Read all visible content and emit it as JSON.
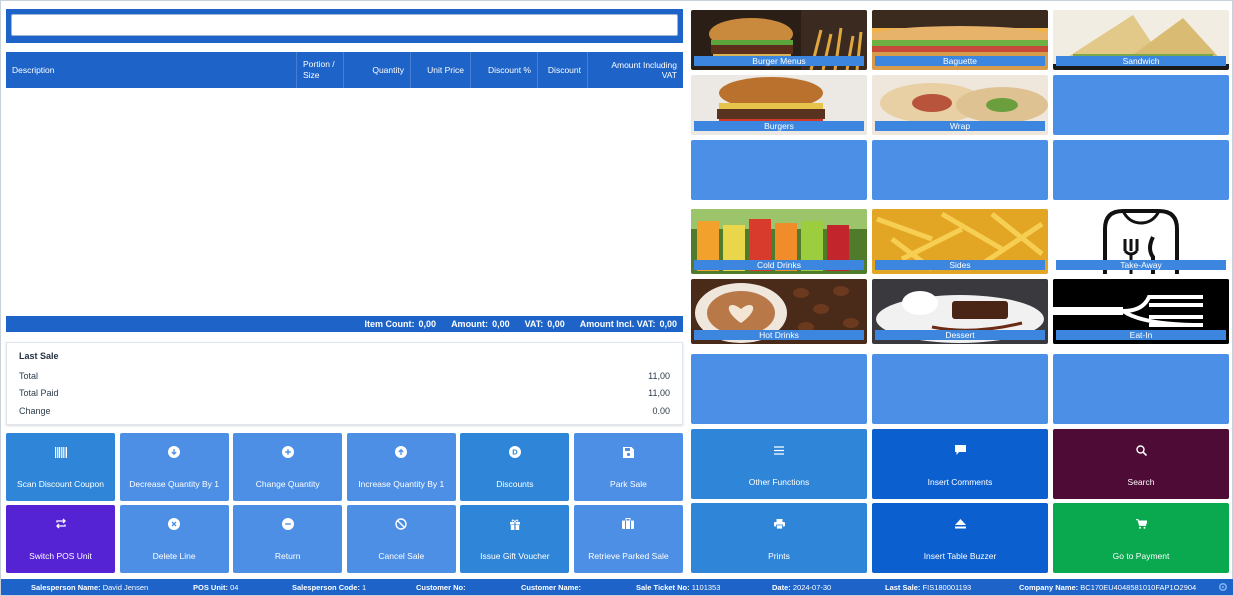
{
  "search": {
    "value": "",
    "placeholder": ""
  },
  "grid": {
    "columns": [
      "Description",
      "Portion / Size",
      "Quantity",
      "Unit Price",
      "Discount %",
      "Discount",
      "Amount Including VAT"
    ],
    "rows": []
  },
  "totals": {
    "item_count_label": "Item Count:",
    "item_count": "0,00",
    "amount_label": "Amount:",
    "amount": "0,00",
    "vat_label": "VAT:",
    "vat": "0,00",
    "amount_incl_label": "Amount Incl. VAT:",
    "amount_incl": "0,00"
  },
  "last_sale": {
    "title": "Last Sale",
    "rows": [
      {
        "label": "Total",
        "value": "11,00"
      },
      {
        "label": "Total Paid",
        "value": "11,00"
      },
      {
        "label": "Change",
        "value": "0.00"
      }
    ]
  },
  "actions": [
    {
      "label": "Scan Discount Coupon",
      "icon": "barcode-icon"
    },
    {
      "label": "Decrease Quantity By 1",
      "icon": "arrow-down-circle-icon"
    },
    {
      "label": "Change Quantity",
      "icon": "plus-circle-icon"
    },
    {
      "label": "Increase Quantity By 1",
      "icon": "arrow-up-circle-icon"
    },
    {
      "label": "Discounts",
      "icon": "discount-icon"
    },
    {
      "label": "Park Sale",
      "icon": "save-icon"
    },
    {
      "label": "Switch POS Unit",
      "icon": "switch-icon"
    },
    {
      "label": "Delete Line",
      "icon": "x-circle-icon"
    },
    {
      "label": "Return",
      "icon": "minus-circle-icon"
    },
    {
      "label": "Cancel Sale",
      "icon": "ban-icon"
    },
    {
      "label": "Issue Gift Voucher",
      "icon": "gift-icon"
    },
    {
      "label": "Retrieve Parked Sale",
      "icon": "briefcase-icon"
    }
  ],
  "tiles": {
    "burger_menus": "Burger Menus",
    "baguette": "Baguette",
    "sandwich": "Sandwich",
    "burgers": "Burgers",
    "wrap": "Wrap",
    "cold_drinks": "Cold Drinks",
    "sides": "Sides",
    "take_away": "Take-Away",
    "hot_drinks": "Hot Drinks",
    "dessert": "Dessert",
    "eat_in": "Eat-In"
  },
  "functions": {
    "other_functions": "Other Functions",
    "insert_comments": "Insert Comments",
    "search": "Search",
    "prints": "Prints",
    "insert_table_buzzer": "Insert Table Buzzer",
    "go_to_payment": "Go to Payment"
  },
  "status": {
    "salesperson_name_label": "Salesperson Name:",
    "salesperson_name": "David Jensen",
    "pos_unit_label": "POS Unit:",
    "pos_unit": "04",
    "salesperson_code_label": "Salesperson Code:",
    "salesperson_code": "1",
    "customer_no_label": "Customer No:",
    "customer_no": "",
    "customer_name_label": "Customer Name:",
    "customer_name": "",
    "sale_ticket_label": "Sale Ticket No:",
    "sale_ticket": "1101353",
    "date_label": "Date:",
    "date": "2024-07-30",
    "last_sale_label": "Last Sale:",
    "last_sale": "FIS180001193",
    "company_name_label": "Company Name:",
    "company_name": "BC170EU4048581010FAP1O2904"
  },
  "colors": {
    "primary": "#1e63c8",
    "tile_empty": "#4c8fe6",
    "button_mid": "#2f86d8",
    "purple": "#5522d4",
    "plum": "#4d0b36",
    "green": "#0aa84f"
  }
}
